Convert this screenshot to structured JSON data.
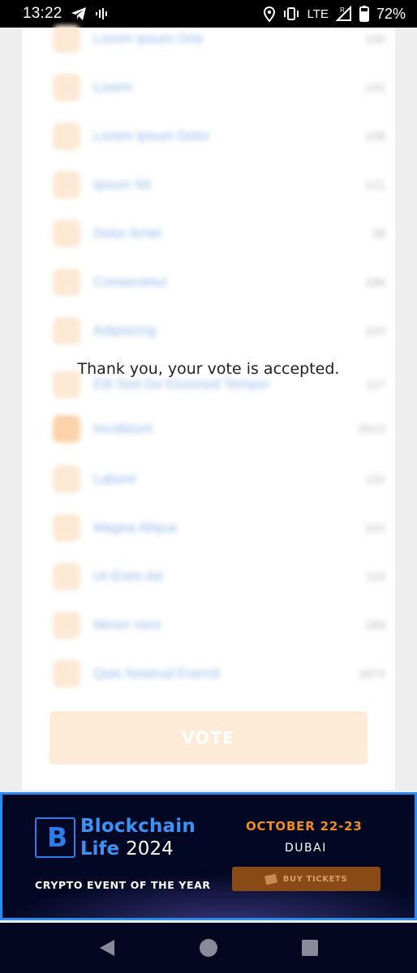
{
  "status_bar": {
    "time": "13:22",
    "network": "LTE",
    "battery": "72%"
  },
  "list": {
    "rows": [
      {
        "name": "Lorem Ipsum One",
        "count": "150"
      },
      {
        "name": "Lorem",
        "count": "142"
      },
      {
        "name": "Lorem Ipsum Dolor",
        "count": "198"
      },
      {
        "name": "Ipsum Sit",
        "count": "121"
      },
      {
        "name": "Dolor Amet",
        "count": "38"
      },
      {
        "name": "Consectetur",
        "count": "186"
      },
      {
        "name": "Adipiscing",
        "count": "163"
      },
      {
        "name": "Elit Sed Do Eiusmod Tempor",
        "count": "117"
      },
      {
        "name": "Incididunt",
        "count": "2613"
      },
      {
        "name": "Labore",
        "count": "131"
      },
      {
        "name": "Magna Aliqua",
        "count": "152"
      },
      {
        "name": "Ut Enim Ad",
        "count": "119"
      },
      {
        "name": "Minim Veni",
        "count": "183"
      },
      {
        "name": "Quis Nostrud Exercit",
        "count": "1874"
      }
    ]
  },
  "message": "Thank you, your vote is accepted.",
  "vote_button": "VOTE",
  "banner": {
    "brand_line1": "Blockchain",
    "brand_line2": "Life",
    "brand_year": "2024",
    "tagline": "CRYPTO EVENT OF THE YEAR",
    "date": "OCTOBER 22-23",
    "city": "DUBAI",
    "tickets_label": "BUY TICKETS",
    "accent_color": "#f28c1a",
    "brand_color": "#3a93f5"
  },
  "nav": {
    "back": "back-icon",
    "home": "home-icon",
    "recents": "recents-icon"
  }
}
